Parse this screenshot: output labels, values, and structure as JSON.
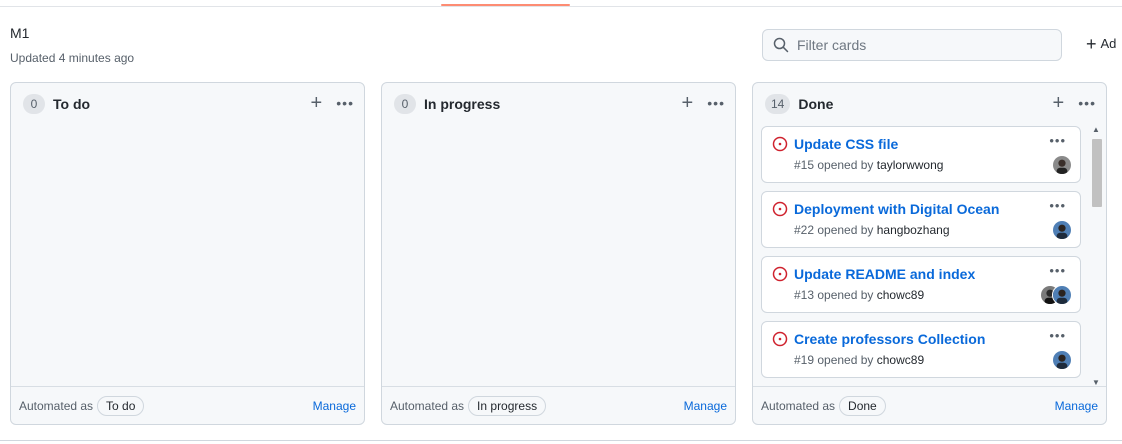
{
  "project": {
    "title": "M1",
    "updated": "Updated 4 minutes ago"
  },
  "toolbar": {
    "filter_placeholder": "Filter cards",
    "add_label": "Ad"
  },
  "columns": [
    {
      "count": "0",
      "name": "To do",
      "automated_label": "Automated as",
      "automated_value": "To do",
      "manage": "Manage",
      "cards": []
    },
    {
      "count": "0",
      "name": "In progress",
      "automated_label": "Automated as",
      "automated_value": "In progress",
      "manage": "Manage",
      "cards": []
    },
    {
      "count": "14",
      "name": "Done",
      "automated_label": "Automated as",
      "automated_value": "Done",
      "manage": "Manage",
      "cards": [
        {
          "title": "Update CSS file",
          "meta_prefix": "#15 opened by",
          "user": "taylorwwong"
        },
        {
          "title": "Deployment with Digital Ocean",
          "meta_prefix": "#22 opened by",
          "user": "hangbozhang"
        },
        {
          "title": "Update README and index",
          "meta_prefix": "#13 opened by",
          "user": "chowc89"
        },
        {
          "title": "Create professors Collection",
          "meta_prefix": "#19 opened by",
          "user": "chowc89"
        }
      ]
    }
  ],
  "colors": {
    "accent": "#0969da",
    "closed_issue": "#cf222e",
    "tab_underline": "#fd8c73"
  }
}
